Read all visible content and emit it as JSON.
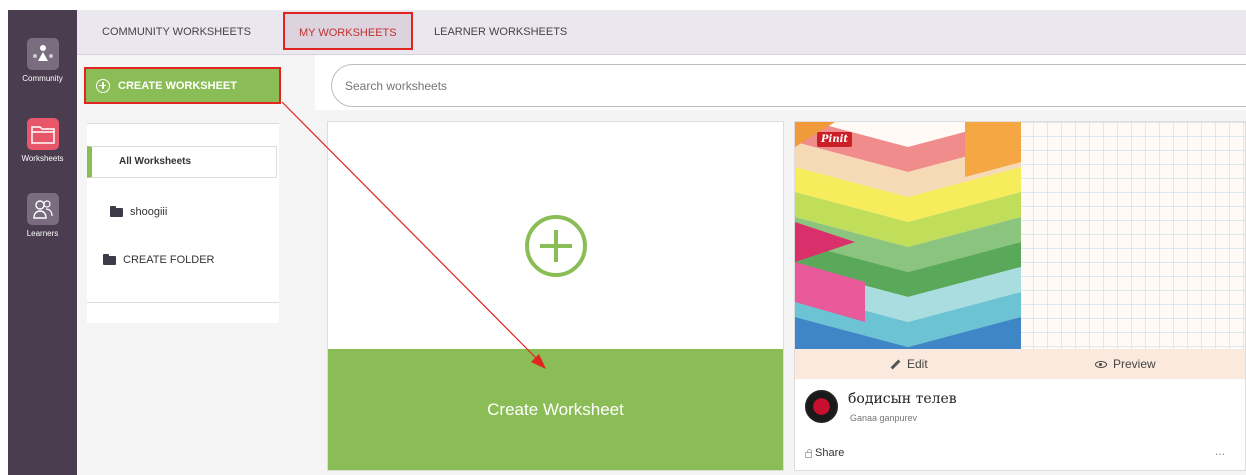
{
  "rail": {
    "items": [
      {
        "label": "Community",
        "icon": "community-icon"
      },
      {
        "label": "Worksheets",
        "icon": "folder-icon"
      },
      {
        "label": "Learners",
        "icon": "learners-icon"
      }
    ]
  },
  "tabs": [
    {
      "label": "COMMUNITY WORKSHEETS"
    },
    {
      "label": "MY WORKSHEETS",
      "active": true
    },
    {
      "label": "LEARNER WORKSHEETS"
    }
  ],
  "sidebar": {
    "create_button": "CREATE WORKSHEET",
    "all_worksheets": "All Worksheets",
    "folders": [
      {
        "label": "shoogiii"
      },
      {
        "label": "CREATE FOLDER"
      }
    ]
  },
  "search": {
    "placeholder": "Search worksheets"
  },
  "new_card": {
    "label": "Create Worksheet"
  },
  "worksheet_card": {
    "pin_label": "Pinit",
    "edit_label": "Edit",
    "preview_label": "Preview",
    "title": "бодисын телев",
    "author": "Ganaa ganpurev",
    "share_label": "Share",
    "more_label": "..."
  },
  "colors": {
    "accent_green": "#8bbd57",
    "annotation_red": "#e0241f",
    "rail_bg": "#4a3d4f",
    "worksheets_active": "#e8566a"
  }
}
